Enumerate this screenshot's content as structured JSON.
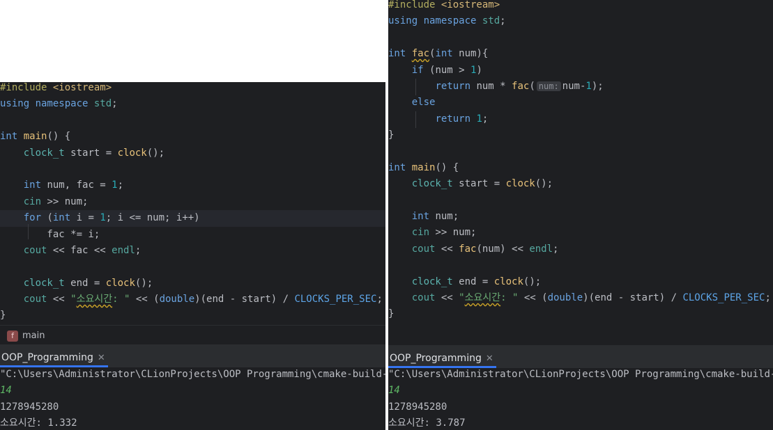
{
  "left": {
    "code": [
      [
        [
          "pre",
          "#include "
        ],
        [
          "inc",
          "<iostream>"
        ]
      ],
      [
        [
          "kwb",
          "using namespace "
        ],
        [
          "cls",
          "std"
        ],
        [
          "",
          "; "
        ]
      ],
      [
        [
          "",
          ""
        ]
      ],
      [
        [
          "kwb",
          "int "
        ],
        [
          "fn",
          "main"
        ],
        [
          "",
          "() {"
        ]
      ],
      [
        [
          "",
          "    "
        ],
        [
          "typ",
          "clock_t"
        ],
        [
          "",
          " start = "
        ],
        [
          "fn",
          "clock"
        ],
        [
          "",
          "();"
        ]
      ],
      [
        [
          "",
          ""
        ]
      ],
      [
        [
          "",
          "    "
        ],
        [
          "kwb",
          "int "
        ],
        [
          "",
          "num, fac = "
        ],
        [
          "num",
          "1"
        ],
        [
          "",
          ";"
        ]
      ],
      [
        [
          "",
          "    "
        ],
        [
          "cls",
          "cin"
        ],
        [
          "",
          " >> num;"
        ]
      ],
      [
        [
          "",
          "    "
        ],
        [
          "kwb",
          "for "
        ],
        [
          "",
          "("
        ],
        [
          "kwb",
          "int "
        ],
        [
          "",
          "i = "
        ],
        [
          "num",
          "1"
        ],
        [
          "",
          "; i <= num; i++)"
        ]
      ],
      [
        [
          "",
          "        fac *= i;"
        ]
      ],
      [
        [
          "",
          "    "
        ],
        [
          "cls",
          "cout"
        ],
        [
          "",
          " << fac << "
        ],
        [
          "cls",
          "endl"
        ],
        [
          "",
          ";"
        ]
      ],
      [
        [
          "",
          ""
        ]
      ],
      [
        [
          "",
          "    "
        ],
        [
          "typ",
          "clock_t"
        ],
        [
          "",
          " end = "
        ],
        [
          "fn",
          "clock"
        ],
        [
          "",
          "();"
        ]
      ],
      [
        [
          "",
          "    "
        ],
        [
          "cls",
          "cout"
        ],
        [
          "",
          " << "
        ],
        [
          "str",
          "\""
        ],
        [
          "strw",
          "소요시간"
        ],
        [
          "str",
          ": \""
        ],
        [
          "",
          " << ("
        ],
        [
          "kwb",
          "double"
        ],
        [
          "",
          ")(end - start) / "
        ],
        [
          "mac",
          "CLOCKS_PER_SEC"
        ],
        [
          "",
          ";"
        ]
      ],
      [
        [
          "",
          "}"
        ]
      ]
    ],
    "breadcrumb": {
      "badge": "f",
      "label": "main"
    },
    "run_tab": {
      "label": "OOP_Programming",
      "close": "✕"
    },
    "console": [
      {
        "text": "\"C:\\Users\\Administrator\\CLionProjects\\OOP Programming\\cmake-build-debug\\OOP_Programming.exe\"",
        "type": "path"
      },
      {
        "text": "14",
        "type": "input"
      },
      {
        "text": "1278945280",
        "type": "output"
      },
      {
        "text": "소요시간: 1.332",
        "type": "output"
      }
    ]
  },
  "right": {
    "code": [
      [
        [
          "pre",
          "#include "
        ],
        [
          "inc",
          "<iostream>"
        ]
      ],
      [
        [
          "kwb",
          "using namespace "
        ],
        [
          "cls",
          "std"
        ],
        [
          "",
          ";"
        ]
      ],
      [
        [
          "",
          ""
        ]
      ],
      [
        [
          "kwb",
          "int "
        ],
        [
          "fnw",
          "fac"
        ],
        [
          "",
          "("
        ],
        [
          "kwb",
          "int "
        ],
        [
          "",
          "num){"
        ]
      ],
      [
        [
          "",
          "    "
        ],
        [
          "kwb",
          "if "
        ],
        [
          "",
          "(num > "
        ],
        [
          "num",
          "1"
        ],
        [
          "",
          ")"
        ]
      ],
      [
        [
          "",
          "        "
        ],
        [
          "kwb",
          "return "
        ],
        [
          "",
          "num * "
        ],
        [
          "fn",
          "fac"
        ],
        [
          "",
          "("
        ],
        [
          "hint",
          "num:"
        ],
        [
          "",
          "num-"
        ],
        [
          "num",
          "1"
        ],
        [
          "",
          ");"
        ]
      ],
      [
        [
          "",
          "    "
        ],
        [
          "kwb",
          "else"
        ]
      ],
      [
        [
          "",
          "        "
        ],
        [
          "kwb",
          "return "
        ],
        [
          "num",
          "1"
        ],
        [
          "",
          ";"
        ]
      ],
      [
        [
          "",
          "}"
        ]
      ],
      [
        [
          "",
          ""
        ]
      ],
      [
        [
          "kwb",
          "int "
        ],
        [
          "fn",
          "main"
        ],
        [
          "",
          "() {"
        ]
      ],
      [
        [
          "",
          "    "
        ],
        [
          "typ",
          "clock_t"
        ],
        [
          "",
          " start = "
        ],
        [
          "fn",
          "clock"
        ],
        [
          "",
          "();"
        ]
      ],
      [
        [
          "",
          ""
        ]
      ],
      [
        [
          "",
          "    "
        ],
        [
          "kwb",
          "int "
        ],
        [
          "",
          "num;"
        ]
      ],
      [
        [
          "",
          "    "
        ],
        [
          "cls",
          "cin"
        ],
        [
          "",
          " >> num;"
        ]
      ],
      [
        [
          "",
          "    "
        ],
        [
          "cls",
          "cout"
        ],
        [
          "",
          " << "
        ],
        [
          "fn",
          "fac"
        ],
        [
          "",
          "(num) << "
        ],
        [
          "cls",
          "endl"
        ],
        [
          "",
          ";"
        ]
      ],
      [
        [
          "",
          ""
        ]
      ],
      [
        [
          "",
          "    "
        ],
        [
          "typ",
          "clock_t"
        ],
        [
          "",
          " end = "
        ],
        [
          "fn",
          "clock"
        ],
        [
          "",
          "();"
        ]
      ],
      [
        [
          "",
          "    "
        ],
        [
          "cls",
          "cout"
        ],
        [
          "",
          " << "
        ],
        [
          "str",
          "\""
        ],
        [
          "strw",
          "소요시간"
        ],
        [
          "str",
          ": \""
        ],
        [
          "",
          " << ("
        ],
        [
          "kwb",
          "double"
        ],
        [
          "",
          ")(end - start) / "
        ],
        [
          "mac",
          "CLOCKS_PER_SEC"
        ],
        [
          "",
          ";"
        ]
      ],
      [
        [
          "",
          "}"
        ]
      ]
    ],
    "run_tab": {
      "label": "OOP_Programming",
      "close": "✕"
    },
    "console": [
      {
        "text": "\"C:\\Users\\Administrator\\CLionProjects\\OOP Programming\\cmake-build-debug\\OOP_Programming.exe\"",
        "type": "path"
      },
      {
        "text": "14",
        "type": "input"
      },
      {
        "text": "1278945280",
        "type": "output"
      },
      {
        "text": "소요시간: 3.787",
        "type": "output"
      }
    ]
  }
}
